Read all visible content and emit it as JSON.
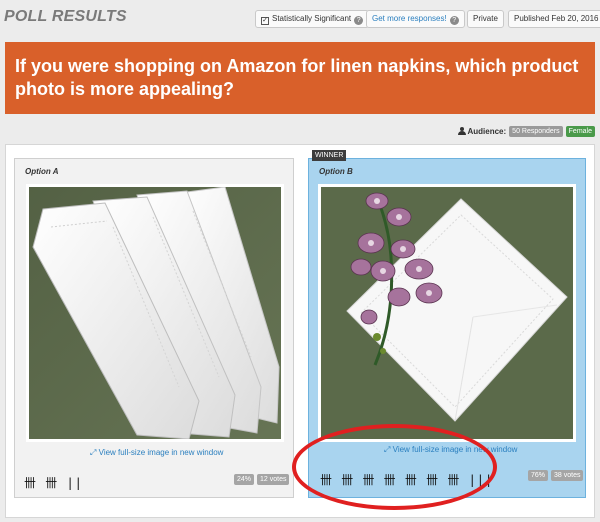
{
  "header": {
    "title": "POLL RESULTS",
    "statistically_significant": "Statistically Significant",
    "get_more": "Get more responses!",
    "help_glyph": "?",
    "visibility": "Private",
    "published": "Published Feb 20, 2016"
  },
  "question": "If you were shopping on Amazon for linen napkins, which product photo is more appealing?",
  "audience": {
    "label": "Audience:",
    "responders": "50 Responders",
    "gender": "Female"
  },
  "options": [
    {
      "label": "Option A",
      "view_link": "View full-size image in new window",
      "tally": "卌 卌 ||",
      "percent": "24%",
      "votes": "12 votes",
      "winner": false
    },
    {
      "label": "Option B",
      "view_link": "View full-size image in new window",
      "tally": "卌 卌 卌 卌 卌 卌 卌 |||",
      "percent": "76%",
      "votes": "38 votes",
      "winner": true,
      "winner_label": "WINNER"
    }
  ],
  "icons": {
    "audience": "person-icon",
    "checkbox": "check-icon",
    "expand": "expand-icon",
    "help": "help-icon"
  },
  "colors": {
    "question_bg": "#d9602a",
    "winner_bg": "#a9d4ef",
    "link": "#2a7fbf",
    "annotation": "#e02020"
  }
}
